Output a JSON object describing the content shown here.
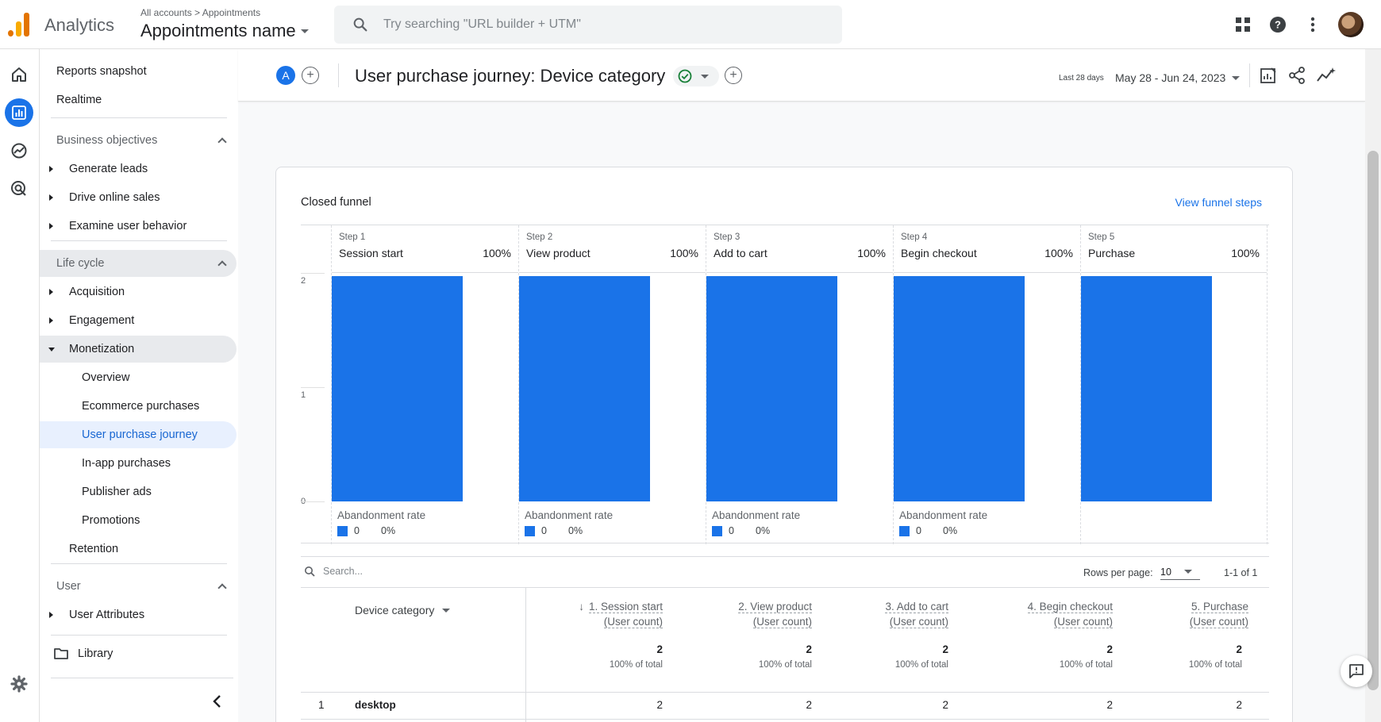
{
  "topbar": {
    "app_name": "Analytics",
    "breadcrumb_root": "All accounts",
    "breadcrumb_sep": ">",
    "breadcrumb_leaf": "Appointments",
    "property_name": "Appointments name",
    "search_placeholder": "Try searching \"URL builder + UTM\"",
    "icons": [
      "apps-grid-icon",
      "help-icon",
      "more-vert-icon",
      "avatar"
    ]
  },
  "rail": {
    "icons": [
      "home-icon",
      "reports-icon",
      "explore-icon",
      "advertising-icon",
      "settings-icon"
    ],
    "active": "reports-icon"
  },
  "sidebar": {
    "reports_snapshot": "Reports snapshot",
    "realtime": "Realtime",
    "business_objectives": "Business objectives",
    "generate_leads": "Generate leads",
    "drive_online_sales": "Drive online sales",
    "examine_user_behavior": "Examine user behavior",
    "life_cycle": "Life cycle",
    "acquisition": "Acquisition",
    "engagement": "Engagement",
    "monetization": "Monetization",
    "overview": "Overview",
    "ecommerce_purchases": "Ecommerce purchases",
    "user_purchase_journey": "User purchase journey",
    "in_app_purchases": "In-app purchases",
    "publisher_ads": "Publisher ads",
    "promotions": "Promotions",
    "retention": "Retention",
    "user": "User",
    "user_attributes": "User Attributes",
    "library": "Library"
  },
  "header": {
    "comparison_badge": "A",
    "title": "User purchase journey: Device category",
    "date_label": "Last 28 days",
    "date_range": "May 28 - Jun 24, 2023"
  },
  "card": {
    "title": "Closed funnel",
    "view_steps": "View funnel steps"
  },
  "chart_data": {
    "type": "bar",
    "title": "Closed funnel",
    "categories": [
      "Session start",
      "View product",
      "Add to cart",
      "Begin checkout",
      "Purchase"
    ],
    "step_labels": [
      "Step 1",
      "Step 2",
      "Step 3",
      "Step 4",
      "Step 5"
    ],
    "step_percents": [
      "100%",
      "100%",
      "100%",
      "100%",
      "100%"
    ],
    "values": [
      2,
      2,
      2,
      2,
      2
    ],
    "ylim": [
      0,
      2
    ],
    "yticks": [
      "2",
      "1",
      "0"
    ],
    "abandonment_label": "Abandonment rate",
    "abandonment": [
      {
        "count": "0",
        "rate": "0%"
      },
      {
        "count": "0",
        "rate": "0%"
      },
      {
        "count": "0",
        "rate": "0%"
      },
      {
        "count": "0",
        "rate": "0%"
      }
    ],
    "bar_color": "#1a73e8"
  },
  "table": {
    "search_placeholder": "Search...",
    "rows_per_page_label": "Rows per page:",
    "rows_per_page": "10",
    "pager": "1-1 of 1",
    "dimension_header": "Device category",
    "columns": [
      {
        "line1": "1. Session start",
        "line2": "(User count)",
        "total": "2",
        "pct": "100% of total"
      },
      {
        "line1": "2. View product",
        "line2": "(User count)",
        "total": "2",
        "pct": "100% of total"
      },
      {
        "line1": "3. Add to cart",
        "line2": "(User count)",
        "total": "2",
        "pct": "100% of total"
      },
      {
        "line1": "4. Begin checkout",
        "line2": "(User count)",
        "total": "2",
        "pct": "100% of total"
      },
      {
        "line1": "5. Purchase",
        "line2": "(User count)",
        "total": "2",
        "pct": "100% of total"
      }
    ],
    "rows": [
      {
        "index": "1",
        "dimension": "desktop",
        "values": [
          "2",
          "2",
          "2",
          "2",
          "2"
        ]
      }
    ]
  }
}
